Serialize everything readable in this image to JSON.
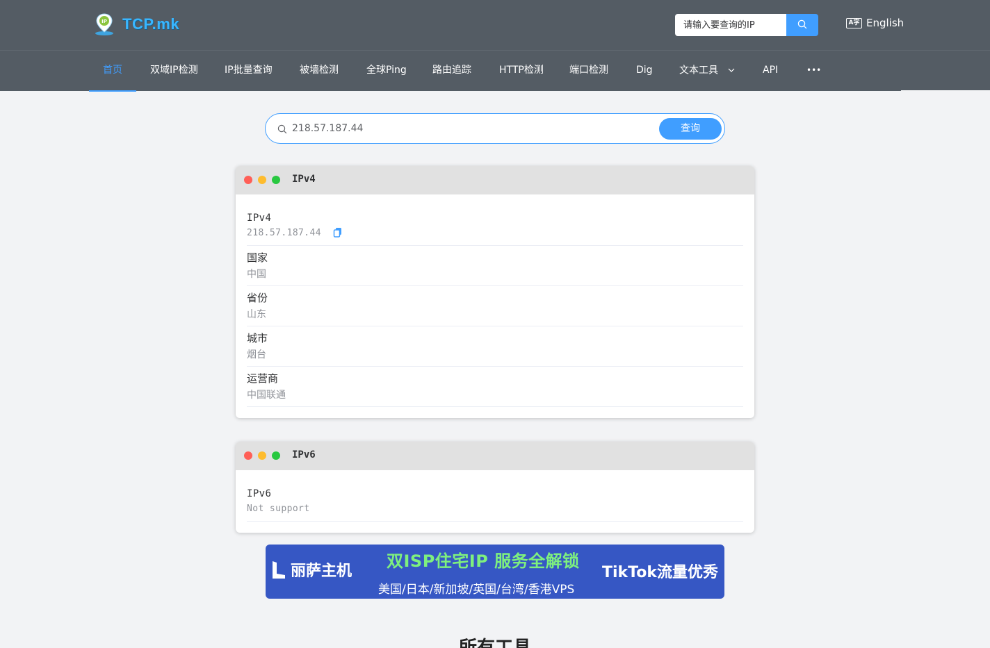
{
  "header": {
    "logo_text": "TCP.mk",
    "search_placeholder": "请输入要查询的IP",
    "language_label": "English",
    "language_icon_text": "A字"
  },
  "nav": {
    "items": [
      {
        "label": "首页",
        "active": true
      },
      {
        "label": "双域IP检测"
      },
      {
        "label": "IP批量查询"
      },
      {
        "label": "被墙检测"
      },
      {
        "label": "全球Ping"
      },
      {
        "label": "路由追踪"
      },
      {
        "label": "HTTP检测"
      },
      {
        "label": "端口检测"
      },
      {
        "label": "Dig"
      },
      {
        "label": "文本工具"
      },
      {
        "label": "API"
      }
    ],
    "more_label": "•••"
  },
  "search": {
    "value": "218.57.187.44",
    "button_label": "查询"
  },
  "ipv4_card": {
    "title": "IPv4",
    "rows": [
      {
        "label": "IPv4",
        "value": "218.57.187.44"
      },
      {
        "label": "国家",
        "value": "中国"
      },
      {
        "label": "省份",
        "value": "山东"
      },
      {
        "label": "城市",
        "value": "烟台"
      },
      {
        "label": "运营商",
        "value": "中国联通"
      }
    ]
  },
  "ipv6_card": {
    "title": "IPv6",
    "rows": [
      {
        "label": "IPv6",
        "value": "Not support"
      }
    ]
  },
  "banner": {
    "brand": "丽萨主机",
    "headline": "双ISP住宅IP  服务全解锁",
    "subline": "美国/日本/新加坡/英国/台湾/香港VPS",
    "right_text": "TikTok流量优秀"
  },
  "section": {
    "title": "所有工具"
  },
  "colors": {
    "header_bg": "#545c64",
    "accent": "#409eff",
    "page_bg": "#f2f3f5",
    "banner_bg": "#3657c4",
    "banner_headline": "#7ef07e"
  }
}
